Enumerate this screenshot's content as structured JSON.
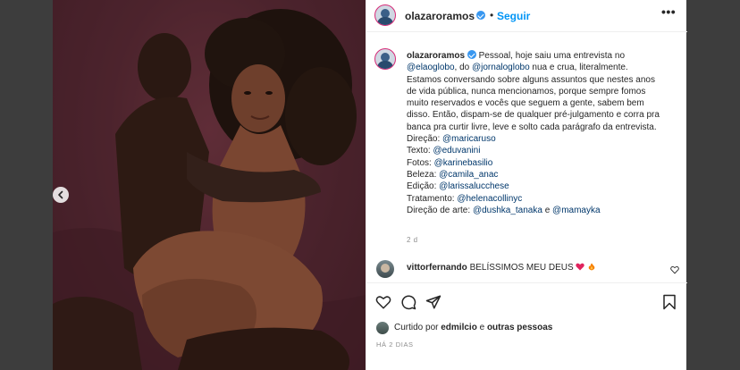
{
  "post": {
    "username": "olazaroramos",
    "dot": "•",
    "follow_label": "Seguir",
    "more_label": "•••",
    "caption_lines": [
      [
        {
          "t": "Pessoal, hoje saiu uma entrevista no",
          "m": false
        }
      ],
      [
        {
          "t": "@elaoglobo",
          "m": true
        },
        {
          "t": ", do ",
          "m": false
        },
        {
          "t": "@jornaloglobo",
          "m": true
        },
        {
          "t": " nua e crua, literalmente.",
          "m": false
        }
      ],
      [
        {
          "t": "Estamos conversando sobre alguns assuntos que nestes anos",
          "m": false
        }
      ],
      [
        {
          "t": "de vida pública, nunca mencionamos, porque sempre fomos",
          "m": false
        }
      ],
      [
        {
          "t": "muito reservados e vocês que seguem a gente, sabem bem",
          "m": false
        }
      ],
      [
        {
          "t": "disso. Então, dispam-se de qualquer pré-julgamento e corra pra",
          "m": false
        }
      ],
      [
        {
          "t": "banca pra curtir livre, leve e solto cada parágrafo da entrevista.",
          "m": false
        }
      ],
      [
        {
          "t": " ",
          "m": false
        }
      ],
      [
        {
          "t": "Direção: ",
          "m": false
        },
        {
          "t": "@maricaruso",
          "m": true
        }
      ],
      [
        {
          "t": "Texto: ",
          "m": false
        },
        {
          "t": "@eduvanini",
          "m": true
        }
      ],
      [
        {
          "t": "Fotos: ",
          "m": false
        },
        {
          "t": "@karinebasilio",
          "m": true
        }
      ],
      [
        {
          "t": "Beleza: ",
          "m": false
        },
        {
          "t": "@camila_anac",
          "m": true
        }
      ],
      [
        {
          "t": "Edição: ",
          "m": false
        },
        {
          "t": "@larissalucchese",
          "m": true
        }
      ],
      [
        {
          "t": "Tratamento: ",
          "m": false
        },
        {
          "t": "@helenacollinyc",
          "m": true
        }
      ],
      [
        {
          "t": "Direção de arte: ",
          "m": false
        },
        {
          "t": "@dushka_tanaka",
          "m": true
        },
        {
          "t": " e ",
          "m": false
        },
        {
          "t": "@mamayka",
          "m": true
        }
      ]
    ],
    "caption_time": "2 d"
  },
  "comment": {
    "username": "vittorfernando",
    "text": "BELÍSSIMOS MEU DEUS",
    "emoji_icons": [
      "heart-emoji-icon",
      "fire-emoji-icon"
    ]
  },
  "likes": {
    "prefix": "Curtido por",
    "user": "edmilcio",
    "middle": "e",
    "others": "outras pessoas"
  },
  "date_label": "HÁ 2 DIAS",
  "colors": {
    "mention": "#00376b",
    "follow": "#0095f6",
    "verified": "#3897f0",
    "meta": "#8e8e8e"
  },
  "icons": {
    "nav": "chevron-left-icon",
    "actions": [
      "heart-icon",
      "comment-icon",
      "share-icon",
      "bookmark-icon"
    ]
  }
}
